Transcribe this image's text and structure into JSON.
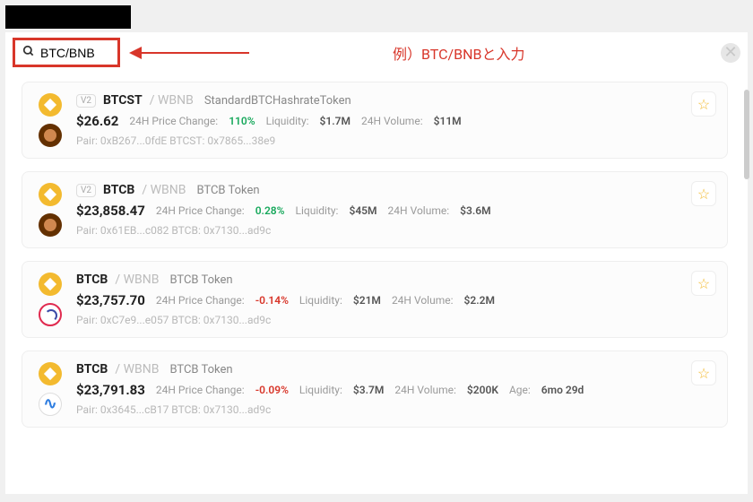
{
  "search": {
    "value": "BTC/BNB"
  },
  "annotation": "例）BTC/BNBと入力",
  "results": [
    {
      "badge": "V2",
      "base": "BTCST",
      "quote": "WBNB",
      "name": "StandardBTCHashrateToken",
      "price": "$26.62",
      "change_label": "24H Price Change:",
      "change": "110%",
      "change_dir": "pos",
      "liq_label": "Liquidity:",
      "liq": "$1.7M",
      "vol_label": "24H Volume:",
      "vol": "$11M",
      "addr": "Pair: 0xB267...0fdE   BTCST: 0x7865...38e9",
      "icons": [
        "bnb",
        "cake"
      ]
    },
    {
      "badge": "V2",
      "base": "BTCB",
      "quote": "WBNB",
      "name": "BTCB Token",
      "price": "$23,858.47",
      "change_label": "24H Price Change:",
      "change": "0.28%",
      "change_dir": "pos",
      "liq_label": "Liquidity:",
      "liq": "$45M",
      "vol_label": "24H Volume:",
      "vol": "$3.6M",
      "addr": "Pair: 0x61EB...c082   BTCB: 0x7130...ad9c",
      "icons": [
        "bnb",
        "cake"
      ]
    },
    {
      "badge": "",
      "base": "BTCB",
      "quote": "WBNB",
      "name": "BTCB Token",
      "price": "$23,757.70",
      "change_label": "24H Price Change:",
      "change": "-0.14%",
      "change_dir": "neg",
      "liq_label": "Liquidity:",
      "liq": "$21M",
      "vol_label": "24H Volume:",
      "vol": "$2.2M",
      "addr": "Pair: 0xC7e9...e057   BTCB: 0x7130...ad9c",
      "icons": [
        "bnb",
        "swirl"
      ]
    },
    {
      "badge": "",
      "base": "BTCB",
      "quote": "WBNB",
      "name": "BTCB Token",
      "price": "$23,791.83",
      "change_label": "24H Price Change:",
      "change": "-0.09%",
      "change_dir": "neg",
      "liq_label": "Liquidity:",
      "liq": "$3.7M",
      "vol_label": "24H Volume:",
      "vol": "$200K",
      "age_label": "Age:",
      "age": "6mo 29d",
      "addr": "Pair: 0x3645...cB17   BTCB: 0x7130...ad9c",
      "icons": [
        "bnb",
        "wave"
      ]
    }
  ]
}
